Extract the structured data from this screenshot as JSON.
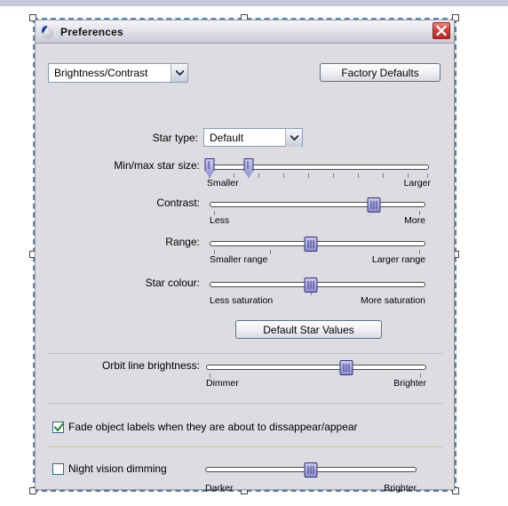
{
  "window": {
    "title": "Preferences",
    "icon": "stellarium-moon-icon",
    "close_icon": "close-icon"
  },
  "toolbar": {
    "category_value": "Brightness/Contrast",
    "factory_defaults_label": "Factory Defaults"
  },
  "star_type": {
    "label": "Star type:",
    "value": "Default"
  },
  "sliders": [
    {
      "name": "min-max-star-size",
      "label": "Min/max star size:",
      "left_label": "Smaller",
      "right_label": "Larger",
      "dual": true,
      "value_min": 1,
      "value_max": 18
    },
    {
      "name": "contrast",
      "label": "Contrast:",
      "left_label": "Less",
      "right_label": "More",
      "dual": false,
      "value": 76
    },
    {
      "name": "range",
      "label": "Range:",
      "left_label": "Smaller range",
      "right_label": "Larger range",
      "dual": false,
      "value": 47
    },
    {
      "name": "star-colour",
      "label": "Star colour:",
      "left_label": "Less saturation",
      "right_label": "More saturation",
      "dual": false,
      "value": 47
    }
  ],
  "default_star_values": {
    "label": "Default Star Values"
  },
  "orbit_line": {
    "label": "Orbit line brightness:",
    "left_label": "Dimmer",
    "right_label": "Brighter",
    "value": 65
  },
  "fade_labels": {
    "label": "Fade object labels when they are about to dissappear/appear",
    "checked": true
  },
  "night_vision": {
    "label": "Night vision dimming",
    "checked": false,
    "left_label": "Darker",
    "right_label": "Brighter",
    "value": 50
  },
  "colors": {
    "dialog_bg": "#dcdce1",
    "handle_fill": "#a8a8dd",
    "handle_border": "#313178",
    "close_red": "#d9413c",
    "check_green": "#1a8a2e",
    "selection_blue": "#5b87b5"
  }
}
